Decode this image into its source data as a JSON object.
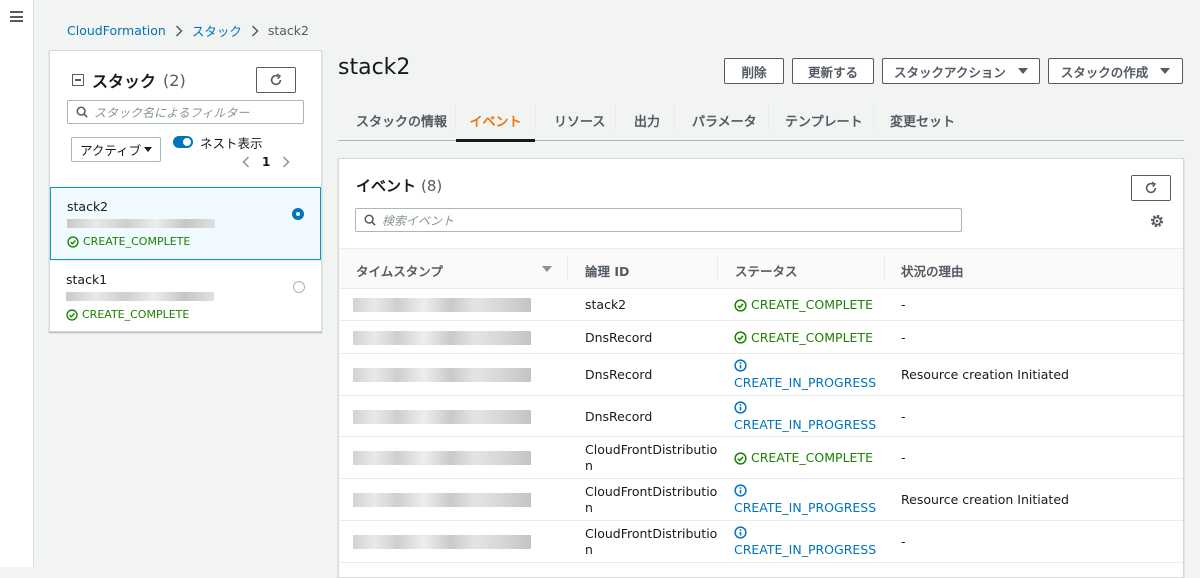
{
  "nav": {
    "menu_icon": "hamburger-icon"
  },
  "breadcrumb": {
    "root": "CloudFormation",
    "section": "スタック",
    "current": "stack2"
  },
  "sidebar": {
    "title": "スタック",
    "count": "(2)",
    "filter_placeholder": "スタック名によるフィルター",
    "status_filter": "アクティブ",
    "nested_toggle_label": "ネスト表示",
    "nested_toggle_on": true,
    "page": "1",
    "stacks": [
      {
        "name": "stack2",
        "status": "CREATE_COMPLETE",
        "selected": true
      },
      {
        "name": "stack1",
        "status": "CREATE_COMPLETE",
        "selected": false
      }
    ]
  },
  "main": {
    "title": "stack2",
    "buttons": {
      "delete": "削除",
      "update": "更新する",
      "stack_actions": "スタックアクション",
      "create_stack": "スタックの作成"
    },
    "tabs": [
      "スタックの情報",
      "イベント",
      "リソース",
      "出力",
      "パラメータ",
      "テンプレート",
      "変更セット"
    ],
    "active_tab": "イベント"
  },
  "events": {
    "title": "イベント",
    "count": "(8)",
    "search_placeholder": "検索イベント",
    "columns": [
      "タイムスタンプ",
      "論理 ID",
      "ステータス",
      "状況の理由"
    ],
    "rows": [
      {
        "logical_id": [
          "stack2"
        ],
        "status": "CREATE_COMPLETE",
        "kind": "ok",
        "reason": "-"
      },
      {
        "logical_id": [
          "DnsRecord"
        ],
        "status": "CREATE_COMPLETE",
        "kind": "ok",
        "reason": "-"
      },
      {
        "logical_id": [
          "DnsRecord"
        ],
        "status": "CREATE_IN_PROGRESS",
        "kind": "progress",
        "reason": "Resource creation Initiated"
      },
      {
        "logical_id": [
          "DnsRecord"
        ],
        "status": "CREATE_IN_PROGRESS",
        "kind": "progress",
        "reason": "-"
      },
      {
        "logical_id": [
          "CloudFrontDistributio",
          "n"
        ],
        "status": "CREATE_COMPLETE",
        "kind": "ok",
        "reason": "-"
      },
      {
        "logical_id": [
          "CloudFrontDistributio",
          "n"
        ],
        "status": "CREATE_IN_PROGRESS",
        "kind": "progress",
        "reason": "Resource creation Initiated"
      },
      {
        "logical_id": [
          "CloudFrontDistributio",
          "n"
        ],
        "status": "CREATE_IN_PROGRESS",
        "kind": "progress",
        "reason": "-"
      }
    ]
  },
  "colors": {
    "link": "#0073bb",
    "success": "#1d8102",
    "active_tab": "#ec7211",
    "border": "#d5dbdb"
  }
}
